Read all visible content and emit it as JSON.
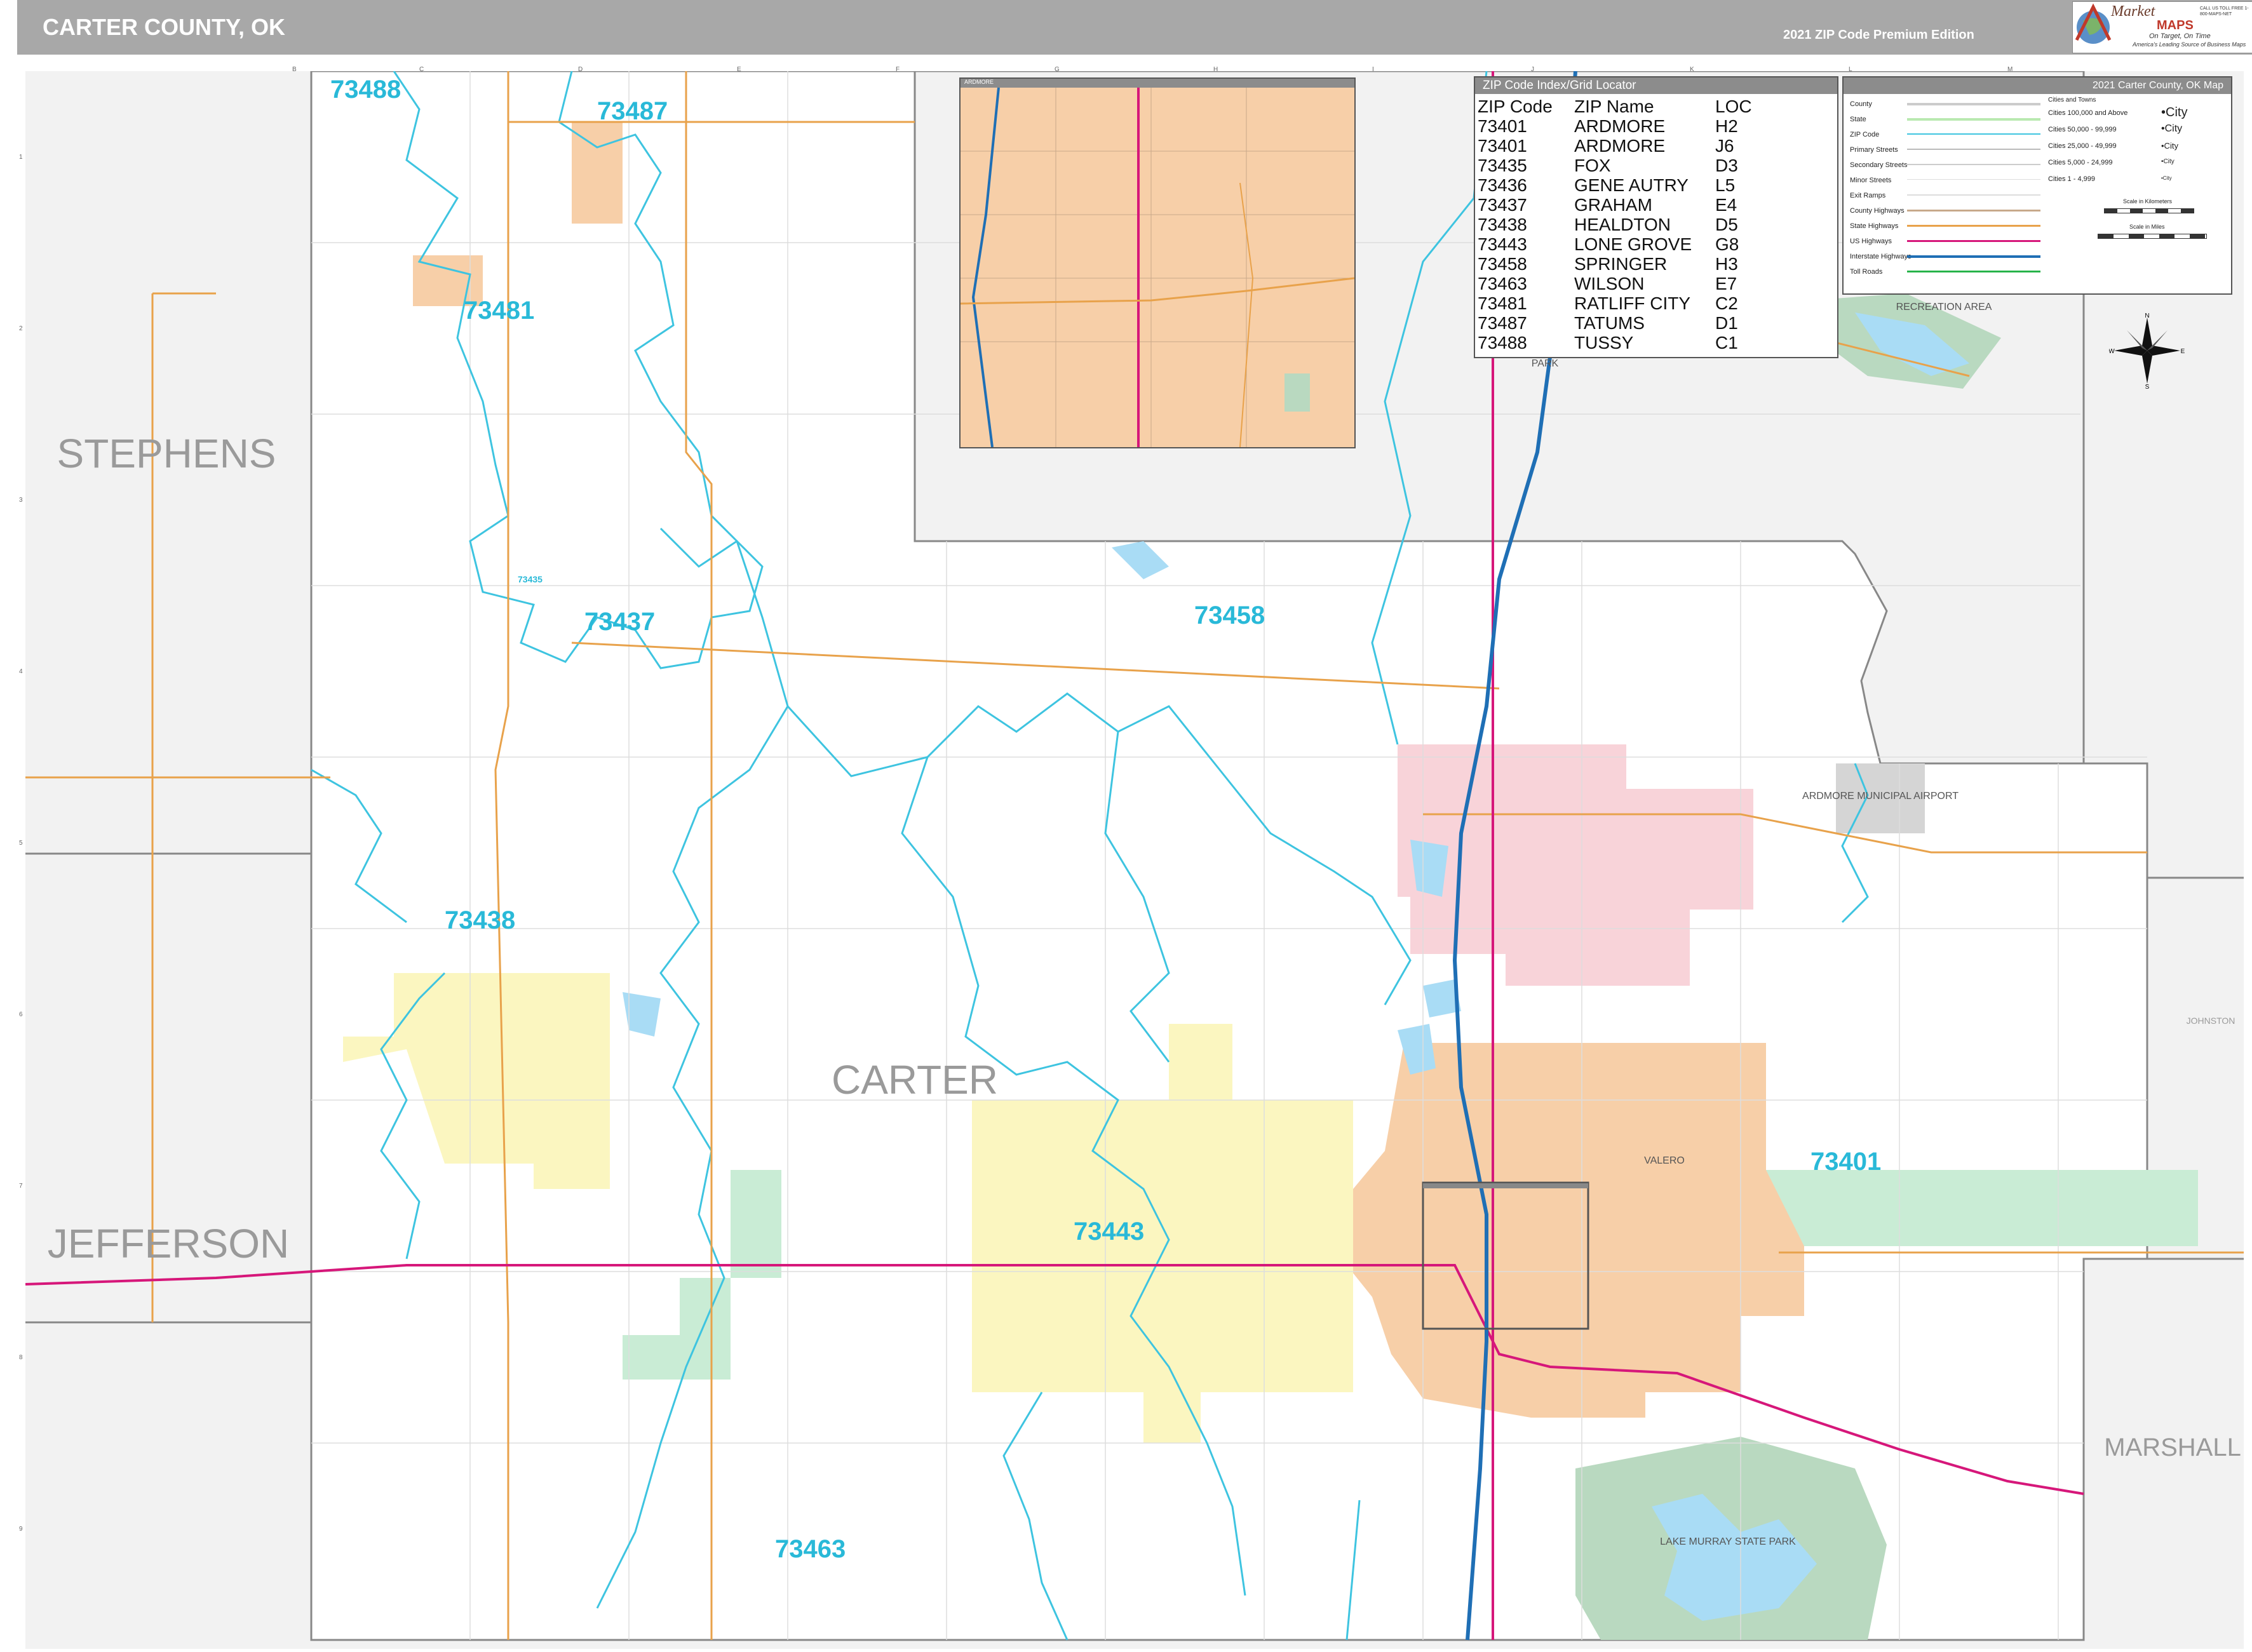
{
  "header": {
    "title": "CARTER COUNTY, OK",
    "edition": "2021 ZIP Code Premium Edition"
  },
  "logo": {
    "brand_top": "Market",
    "brand_bottom": "MAPS",
    "tagline": "On Target, On Time",
    "tagline2": "America's Leading Source of Business Maps",
    "contact": "CALL US TOLL FREE 1-800-MAPS-NET"
  },
  "grid": {
    "columns": [
      "B",
      "C",
      "D",
      "E",
      "F",
      "G",
      "H",
      "I",
      "J",
      "K",
      "L",
      "M"
    ],
    "rows": [
      "1",
      "2",
      "3",
      "4",
      "5",
      "6",
      "7",
      "8",
      "9"
    ]
  },
  "zip_index": {
    "header": "ZIP Code Index/Grid Locator",
    "columns": [
      "ZIP Code",
      "ZIP Name",
      "LOC"
    ],
    "rows": [
      [
        "73401",
        "ARDMORE",
        "H2"
      ],
      [
        "73401",
        "ARDMORE",
        "J6"
      ],
      [
        "73435",
        "FOX",
        "D3"
      ],
      [
        "73436",
        "GENE AUTRY",
        "L5"
      ],
      [
        "73437",
        "GRAHAM",
        "E4"
      ],
      [
        "73438",
        "HEALDTON",
        "D5"
      ],
      [
        "73443",
        "LONE GROVE",
        "G8"
      ],
      [
        "73458",
        "SPRINGER",
        "H3"
      ],
      [
        "73463",
        "WILSON",
        "E7"
      ],
      [
        "73481",
        "RATLIFF CITY",
        "C2"
      ],
      [
        "73487",
        "TATUMS",
        "D1"
      ],
      [
        "73488",
        "TUSSY",
        "C1"
      ]
    ]
  },
  "legend": {
    "header": "2021 Carter County, OK Map",
    "items": [
      "County",
      "State",
      "ZIP Code",
      "Primary Streets",
      "Secondary Streets",
      "Minor Streets",
      "Exit Ramps",
      "County Highways",
      "State Highways",
      "US Highways",
      "Interstate Highways",
      "Toll Roads"
    ],
    "cities_header": "Cities and Towns",
    "cities": [
      {
        "label": "Cities 100,000 and Above",
        "sample": "•City"
      },
      {
        "label": "Cities 50,000 - 99,999",
        "sample": "•City"
      },
      {
        "label": "Cities 25,000 - 49,999",
        "sample": "•City"
      },
      {
        "label": "Cities 5,000 - 24,999",
        "sample": "•City"
      },
      {
        "label": "Cities 1 - 4,999",
        "sample": "•City"
      }
    ],
    "scale_km": "Scale in Kilometers",
    "scale_mi": "Scale in Miles"
  },
  "compass": {
    "n": "N",
    "s": "S",
    "e": "E",
    "w": "W"
  },
  "counties": {
    "stephens": "STEPHENS",
    "jefferson": "JEFFERSON",
    "carter": "CARTER",
    "marshall": "MARSHALL",
    "johnston": "JOHNSTON"
  },
  "zip_labels": {
    "z73488": "73488",
    "z73487": "73487",
    "z73481": "73481",
    "z73437": "73437",
    "z73458": "73458",
    "z73438": "73438",
    "z73443": "73443",
    "z73401": "73401",
    "z73463": "73463",
    "z73435": "73435"
  },
  "places": {
    "airport": "ARDMORE MUNICIPAL AIRPORT",
    "lake": "LAKE MURRAY STATE PARK",
    "recreation": "RECREATION AREA",
    "park": "PARK",
    "valero": "VALERO"
  },
  "inset": {
    "label": "ARDMORE"
  },
  "colors": {
    "zip_line": "#3ec4e0",
    "us_highway": "#d6177a",
    "interstate": "#1f6fb5",
    "state_highway": "#e8a24b",
    "water": "#a9dcf5",
    "ardmore": "#f7cfa8",
    "lone_grove": "#fbf6c0",
    "healdton": "#fbf6c0",
    "gene_autry": "#f8d3d9",
    "wilson_green": "#c9ecd5",
    "park_green": "#b9d9c0"
  }
}
